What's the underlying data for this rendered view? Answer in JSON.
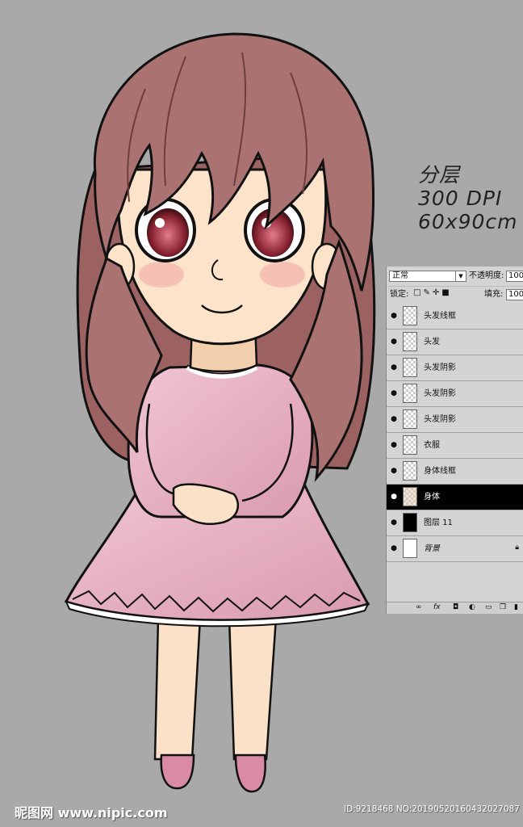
{
  "info": {
    "line1": "分层",
    "line2": "300 DPI",
    "line3": "60x90cm"
  },
  "layers_panel": {
    "blend_mode": "正常",
    "opacity_label": "不透明度:",
    "opacity_value": "100%",
    "lock_label": "锁定:",
    "fill_label": "填充:",
    "fill_value": "100%",
    "layers": [
      {
        "name": "头发线框",
        "thumb": "transparent",
        "selected": false
      },
      {
        "name": "头发",
        "thumb": "transparent",
        "selected": false
      },
      {
        "name": "头发阴影",
        "thumb": "transparent",
        "selected": false
      },
      {
        "name": "头发阴影",
        "thumb": "transparent",
        "selected": false
      },
      {
        "name": "头发阴影",
        "thumb": "transparent",
        "selected": false
      },
      {
        "name": "衣服",
        "thumb": "transparent",
        "selected": false
      },
      {
        "name": "身体线框",
        "thumb": "transparent",
        "selected": false
      },
      {
        "name": "身体",
        "thumb": "transparent",
        "selected": true
      },
      {
        "name": "图层 11",
        "thumb": "black",
        "selected": false
      },
      {
        "name": "背景",
        "thumb": "white",
        "selected": false,
        "locked": true
      }
    ],
    "footer_icons": [
      "link-icon",
      "fx-icon",
      "mask-icon",
      "adjustment-icon",
      "group-icon",
      "new-layer-icon",
      "trash-icon"
    ]
  },
  "watermark": {
    "logo": "昵图网 www.nipic.com",
    "id": "ID:9218468 NO:20190520160432027087"
  },
  "colors": {
    "background": "#a9a9a9",
    "hair": "#a86e6e",
    "dress": "#e8b2c4",
    "skin": "#fbe3cb"
  }
}
